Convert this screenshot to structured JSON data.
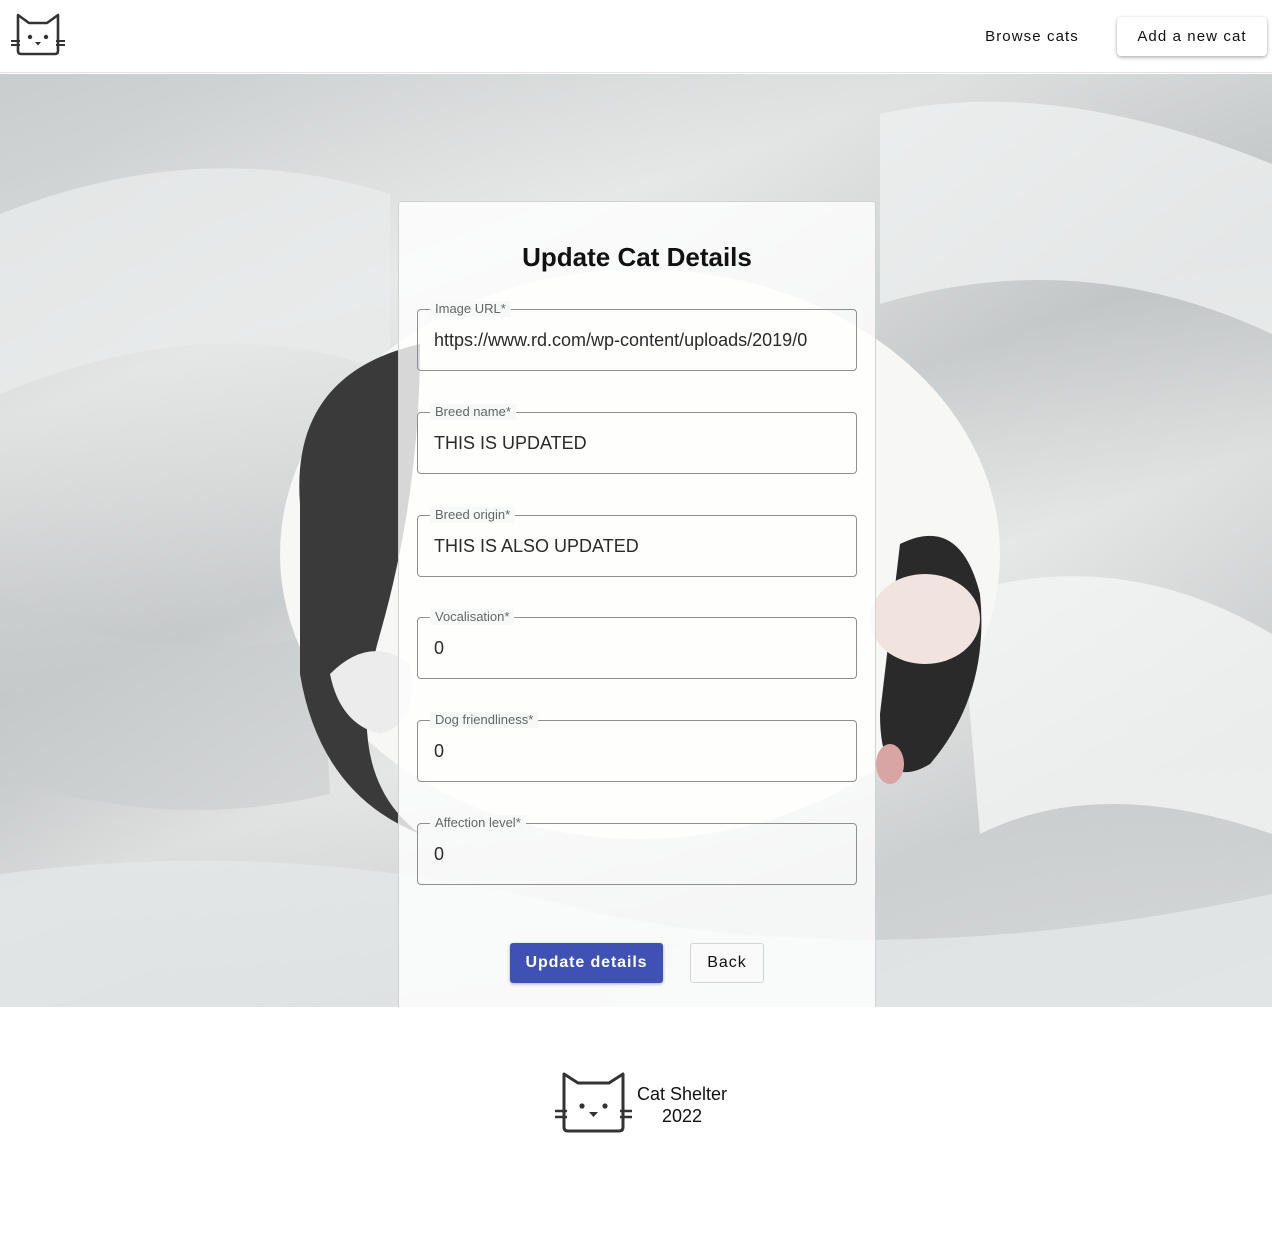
{
  "header": {
    "logo_icon": "cat-face-icon",
    "nav": {
      "browse_label": "Browse cats",
      "add_label": "Add a new cat"
    }
  },
  "form": {
    "title": "Update Cat Details",
    "fields": [
      {
        "label": "Image URL*",
        "value": "https://www.rd.com/wp-content/uploads/2019/0"
      },
      {
        "label": "Breed name*",
        "value": "THIS IS UPDATED"
      },
      {
        "label": "Breed origin*",
        "value": "THIS IS ALSO UPDATED"
      },
      {
        "label": "Vocalisation*",
        "value": "0"
      },
      {
        "label": "Dog friendliness*",
        "value": "0"
      },
      {
        "label": "Affection level*",
        "value": "0"
      }
    ],
    "update_label": "Update details",
    "back_label": "Back"
  },
  "footer": {
    "logo_icon": "cat-face-icon",
    "name": "Cat Shelter",
    "year": "2022"
  },
  "colors": {
    "primary": "#3f51b5",
    "background": "#ffffff"
  }
}
